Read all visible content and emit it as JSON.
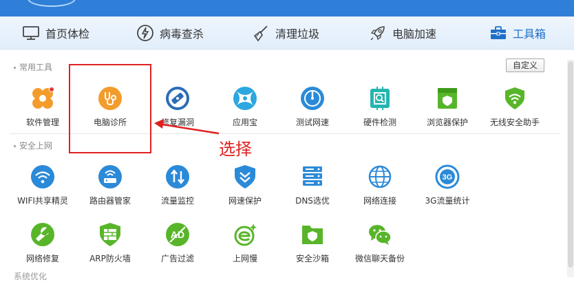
{
  "nav": {
    "items": [
      {
        "label": "首页体检",
        "icon": "monitor-icon"
      },
      {
        "label": "病毒查杀",
        "icon": "lightning-shield-icon"
      },
      {
        "label": "清理垃圾",
        "icon": "broom-icon"
      },
      {
        "label": "电脑加速",
        "icon": "rocket-icon"
      },
      {
        "label": "工具箱",
        "icon": "toolbox-icon"
      }
    ],
    "active_index": 4
  },
  "sections": {
    "common": {
      "label": "常用工具",
      "custom_button": "自定义",
      "tools": [
        {
          "label": "软件管理",
          "icon": "software-manager-icon"
        },
        {
          "label": "电脑诊所",
          "icon": "stethoscope-icon"
        },
        {
          "label": "修复漏洞",
          "icon": "patch-icon"
        },
        {
          "label": "应用宝",
          "icon": "app-store-icon"
        },
        {
          "label": "测试网速",
          "icon": "speed-test-icon"
        },
        {
          "label": "硬件检测",
          "icon": "chip-icon"
        },
        {
          "label": "浏览器保护",
          "icon": "browser-shield-icon"
        },
        {
          "label": "无线安全助手",
          "icon": "wifi-shield-icon"
        }
      ]
    },
    "security": {
      "label": "安全上网",
      "tools": [
        {
          "label": "WIFI共享精灵",
          "icon": "wifi-share-icon"
        },
        {
          "label": "路由器管家",
          "icon": "router-icon"
        },
        {
          "label": "流量监控",
          "icon": "traffic-monitor-icon"
        },
        {
          "label": "网速保护",
          "icon": "speed-protect-icon"
        },
        {
          "label": "DNS选优",
          "icon": "dns-server-icon"
        },
        {
          "label": "网络连接",
          "icon": "globe-icon"
        },
        {
          "label": "3G流量统计",
          "icon": "3g-icon"
        },
        {
          "label": "网络修复",
          "icon": "wrench-icon"
        },
        {
          "label": "ARP防火墙",
          "icon": "firewall-icon"
        },
        {
          "label": "广告过滤",
          "icon": "ad-filter-icon"
        },
        {
          "label": "上网慢",
          "icon": "slow-internet-icon"
        },
        {
          "label": "安全沙箱",
          "icon": "sandbox-icon"
        },
        {
          "label": "微信聊天备份",
          "icon": "wechat-backup-icon"
        }
      ]
    },
    "partial_label": "系统优化"
  },
  "annotation": {
    "callout_text": "选择",
    "color": "#e02020"
  },
  "colors": {
    "top_bar": "#2f7fd8",
    "accent": "#1f6fc6",
    "orange": "#f39c2c",
    "blue": "#2b8ad8",
    "green": "#58b52a"
  }
}
